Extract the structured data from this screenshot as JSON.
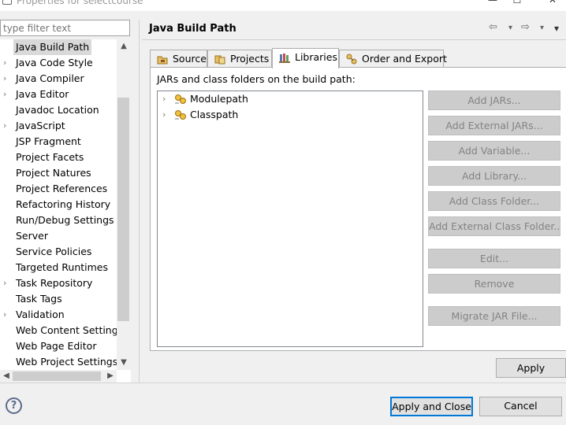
{
  "window": {
    "title": "Properties for selectcourse",
    "minimize_glyph": "—",
    "maximize_glyph": "☐",
    "close_glyph": "✕"
  },
  "filter": {
    "placeholder": "type filter text"
  },
  "nav": {
    "items": [
      {
        "label": "Java Build Path",
        "twisty": false,
        "selected": true
      },
      {
        "label": "Java Code Style",
        "twisty": true
      },
      {
        "label": "Java Compiler",
        "twisty": true
      },
      {
        "label": "Java Editor",
        "twisty": true
      },
      {
        "label": "Javadoc Location",
        "twisty": false
      },
      {
        "label": "JavaScript",
        "twisty": true
      },
      {
        "label": "JSP Fragment",
        "twisty": false
      },
      {
        "label": "Project Facets",
        "twisty": false
      },
      {
        "label": "Project Natures",
        "twisty": false
      },
      {
        "label": "Project References",
        "twisty": false
      },
      {
        "label": "Refactoring History",
        "twisty": false
      },
      {
        "label": "Run/Debug Settings",
        "twisty": false
      },
      {
        "label": "Server",
        "twisty": false
      },
      {
        "label": "Service Policies",
        "twisty": false
      },
      {
        "label": "Targeted Runtimes",
        "twisty": false
      },
      {
        "label": "Task Repository",
        "twisty": true
      },
      {
        "label": "Task Tags",
        "twisty": false
      },
      {
        "label": "Validation",
        "twisty": true
      },
      {
        "label": "Web Content Settings",
        "twisty": false
      },
      {
        "label": "Web Page Editor",
        "twisty": false
      },
      {
        "label": "Web Project Settings",
        "twisty": false
      }
    ]
  },
  "page": {
    "title": "Java Build Path",
    "back_glyph": "⇦",
    "forward_glyph": "⇨",
    "menu_glyph": "▾"
  },
  "tabs": [
    {
      "label": "Source",
      "icon": "source-folder-icon"
    },
    {
      "label": "Projects",
      "icon": "projects-icon"
    },
    {
      "label": "Libraries",
      "icon": "libraries-icon",
      "active": true
    },
    {
      "label": "Order and Export",
      "icon": "order-export-icon"
    }
  ],
  "libraries": {
    "label": "JARs and class folders on the build path:",
    "tree": [
      {
        "label": "Modulepath",
        "icon": "library-icon"
      },
      {
        "label": "Classpath",
        "icon": "library-icon"
      }
    ],
    "buttons": [
      {
        "label": "Add JARs...",
        "enabled": false
      },
      {
        "label": "Add External JARs...",
        "enabled": false
      },
      {
        "label": "Add Variable...",
        "enabled": false
      },
      {
        "label": "Add Library...",
        "enabled": false
      },
      {
        "label": "Add Class Folder...",
        "enabled": false
      },
      {
        "label": "Add External Class Folder...",
        "enabled": false
      },
      {
        "label": "Edit...",
        "enabled": false
      },
      {
        "label": "Remove",
        "enabled": false
      },
      {
        "label": "Migrate JAR File...",
        "enabled": false
      }
    ]
  },
  "footer": {
    "apply": "Apply",
    "help_glyph": "?",
    "apply_close": "Apply and Close",
    "cancel": "Cancel"
  },
  "colors": {
    "selection": "#d9d9d9",
    "default_button_border": "#0078d7",
    "disabled_text": "#838383"
  }
}
